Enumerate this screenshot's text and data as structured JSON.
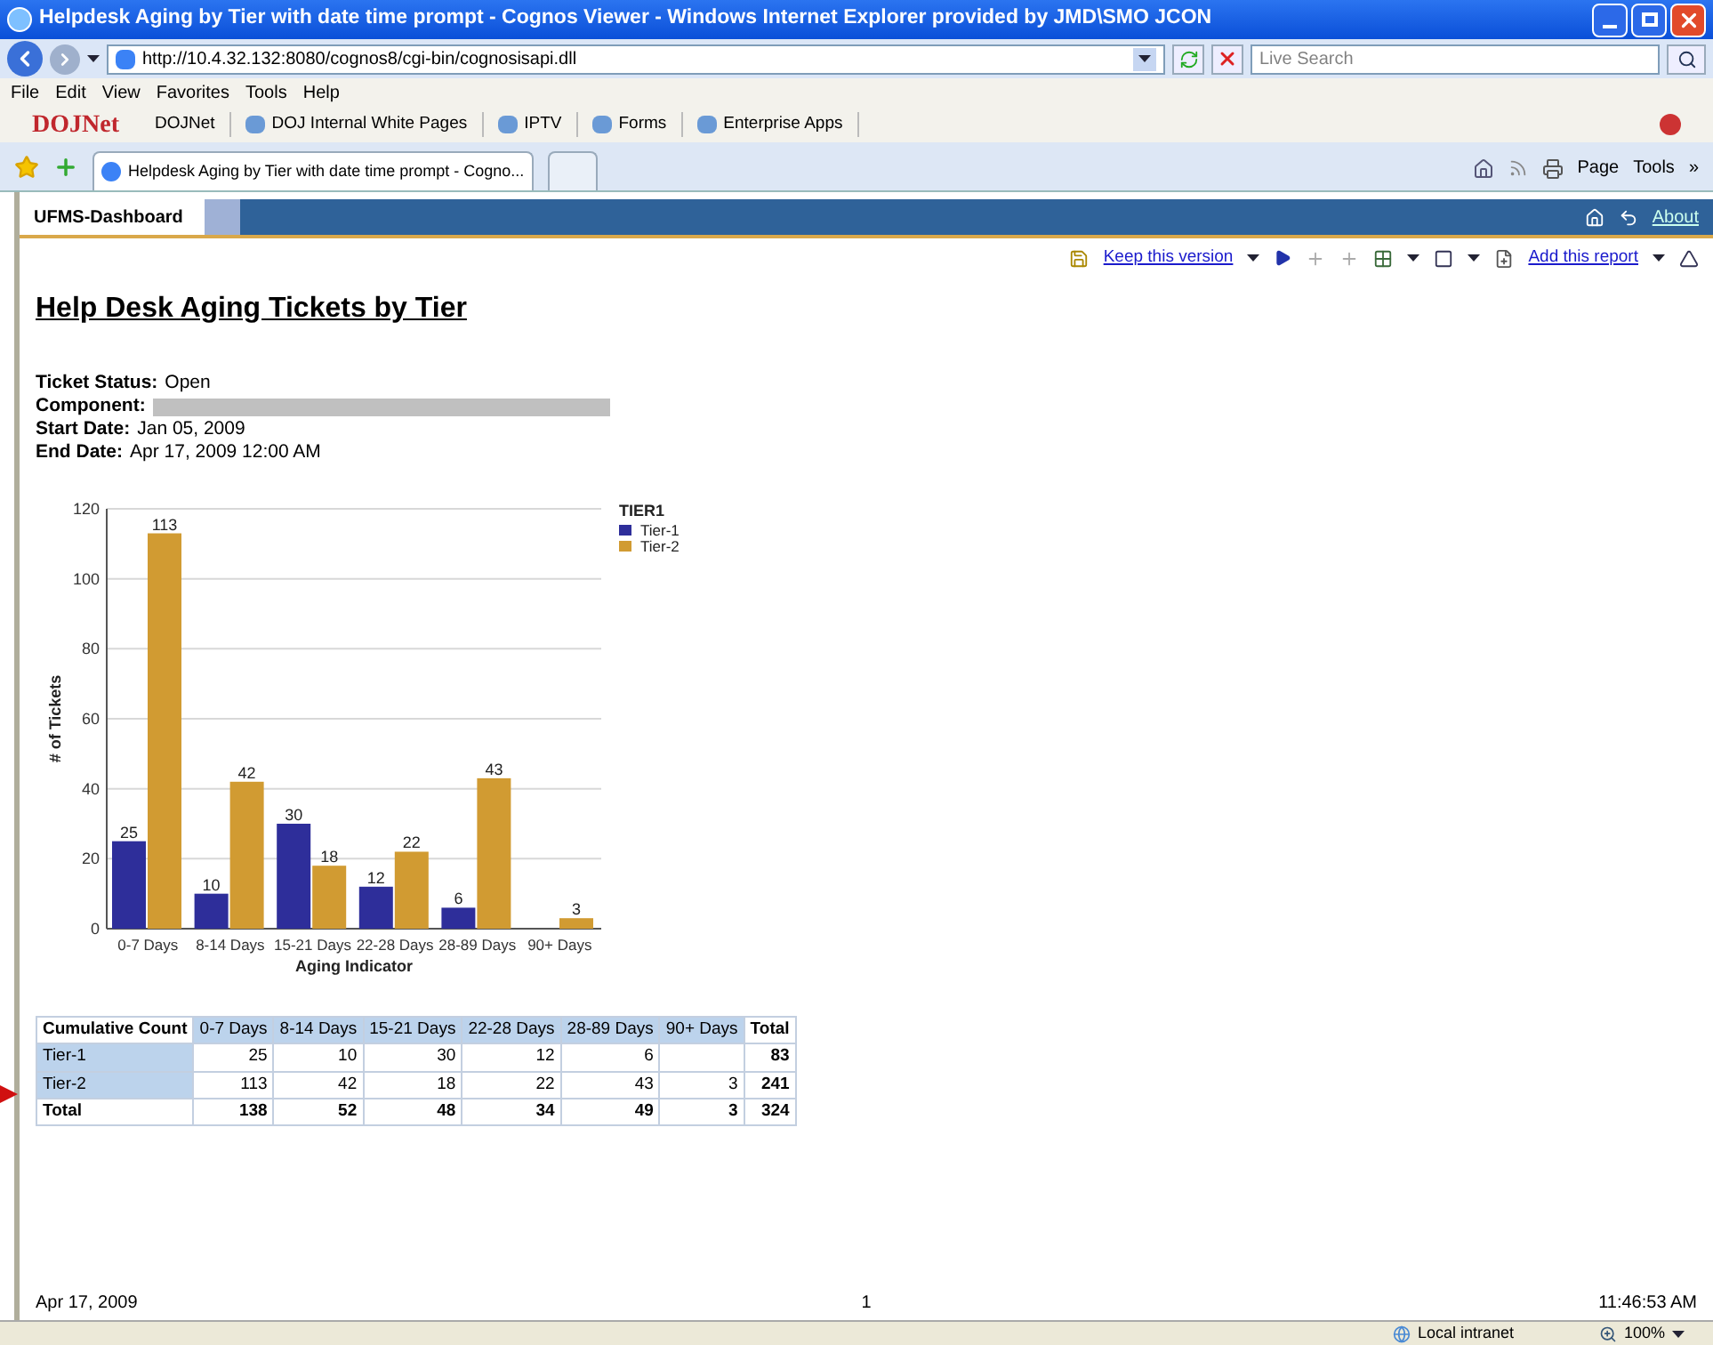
{
  "window": {
    "title": "Helpdesk Aging by Tier with date time prompt - Cognos Viewer - Windows Internet Explorer provided by JMD\\SMO JCON"
  },
  "address_bar": {
    "url": "http://10.4.32.132:8080/cognos8/cgi-bin/cognosisapi.dll"
  },
  "search": {
    "placeholder": "Live Search"
  },
  "menu": [
    "File",
    "Edit",
    "View",
    "Favorites",
    "Tools",
    "Help"
  ],
  "links_bar": {
    "logo": "DOJNet",
    "links": [
      "DOJNet",
      "DOJ Internal White Pages",
      "IPTV",
      "Forms",
      "Enterprise Apps"
    ]
  },
  "browser_tabs": [
    {
      "label": "Helpdesk Aging by Tier with date time prompt - Cogno...",
      "selected": true
    },
    {
      "selected": false
    }
  ],
  "command_bar": [
    "Page",
    "Tools",
    "»"
  ],
  "cognos": {
    "tab": "UFMS-Dashboard",
    "about": "About",
    "toolbar": [
      "Keep this version",
      "Add this report"
    ]
  },
  "report": {
    "title": "Help Desk Aging Tickets by Tier",
    "parameters": [
      {
        "label": "Ticket Status:",
        "value": "Open"
      },
      {
        "label": "Component:",
        "redacted": true
      },
      {
        "label": "Start Date:",
        "value": "Jan 05, 2009"
      },
      {
        "label": "End Date:",
        "value": "Apr 17, 2009 12:00 AM"
      }
    ],
    "chart": {
      "chart_data": {
        "type": "bar",
        "xlabel": "Aging Indicator",
        "ylabel": "# of Tickets",
        "categories": [
          "0-7 Days",
          "8-14 Days",
          "15-21 Days",
          "22-28 Days",
          "28-89 Days",
          "90+ Days"
        ],
        "series": [
          {
            "name": "Tier-1",
            "color": "#2e2e9a",
            "values": [
              25,
              10,
              30,
              12,
              6,
              null
            ]
          },
          {
            "name": "Tier-2",
            "color": "#d19b32",
            "values": [
              113,
              42,
              18,
              22,
              43,
              3
            ]
          }
        ],
        "ylim": [
          0,
          120
        ],
        "yticks": [
          0,
          20,
          40,
          60,
          80,
          100,
          120
        ],
        "data_labels": true,
        "grid": true,
        "legend": {
          "title": "TIER1"
        }
      }
    },
    "table": {
      "columns": [
        "Cumulative Count",
        "0-7 Days",
        "8-14 Days",
        "15-21 Days",
        "22-28 Days",
        "28-89 Days",
        "90+ Days",
        "Total"
      ],
      "rows": [
        {
          "kind": "data",
          "cells": [
            "Tier-1",
            "25",
            "10",
            "30",
            "12",
            "6",
            null,
            "83"
          ]
        },
        {
          "kind": "data",
          "cells": [
            "Tier-2",
            "113",
            "42",
            "18",
            "22",
            "43",
            "3",
            "241"
          ]
        },
        {
          "kind": "total",
          "cells": [
            "Total",
            "138",
            "52",
            "48",
            "34",
            "49",
            "3",
            "324"
          ]
        }
      ]
    },
    "footer": {
      "date": "Apr 17, 2009",
      "page": "1",
      "time": "11:46:53 AM"
    }
  },
  "status_bar": {
    "zone": "Local intranet",
    "zoom": "100%"
  }
}
